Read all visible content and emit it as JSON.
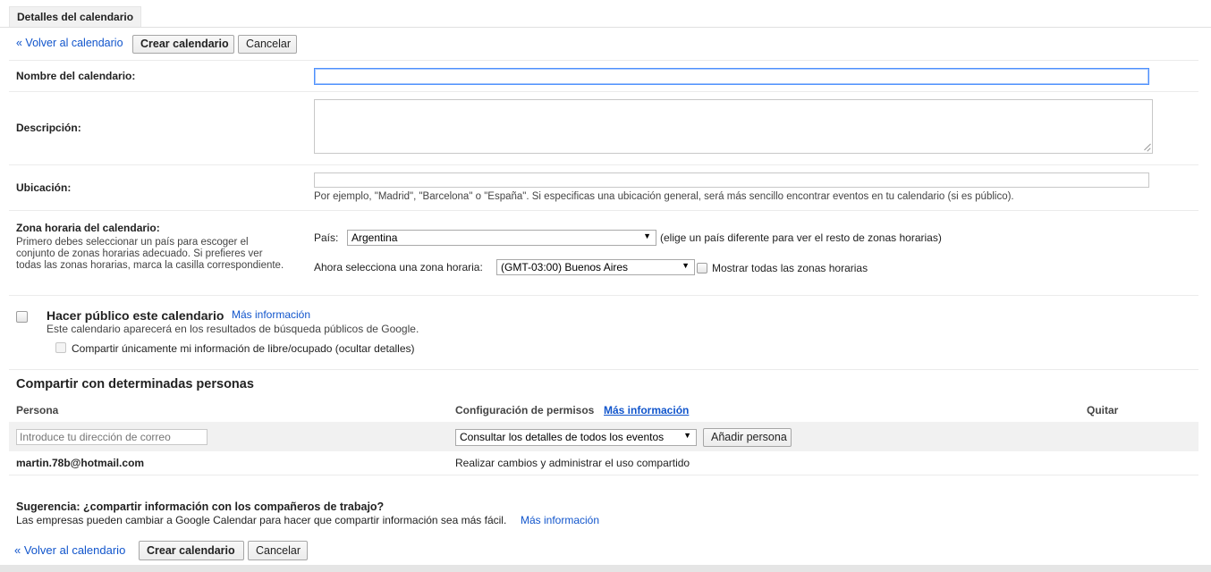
{
  "tab": {
    "label": "Detalles del calendario"
  },
  "toolbar": {
    "back_label": "« Volver al calendario",
    "create_label": "Crear calendario",
    "cancel_label": "Cancelar"
  },
  "form": {
    "name": {
      "label": "Nombre del calendario:",
      "value": ""
    },
    "description": {
      "label": "Descripción:",
      "value": ""
    },
    "location": {
      "label": "Ubicación:",
      "value": "",
      "hint": "Por ejemplo, \"Madrid\", \"Barcelona\" o \"España\". Si especificas una ubicación general, será más sencillo encontrar eventos en tu calendario (si es público)."
    },
    "timezone": {
      "label": "Zona horaria del calendario:",
      "help": "Primero debes seleccionar un país para escoger el conjunto de zonas horarias adecuado. Si prefieres ver todas las zonas horarias, marca la casilla correspondiente.",
      "country_label": "País:",
      "country_value": "Argentina",
      "country_hint": "(elige un país diferente para ver el resto de zonas horarias)",
      "zone_label": "Ahora selecciona una zona horaria:",
      "zone_value": "(GMT-03:00) Buenos Aires",
      "show_all_label": "Mostrar todas las zonas horarias"
    }
  },
  "public": {
    "title": "Hacer público este calendario",
    "more_info": "Más información",
    "description": "Este calendario aparecerá en los resultados de búsqueda públicos de Google.",
    "freebusy_label": "Compartir únicamente mi información de libre/ocupado (ocultar detalles)"
  },
  "sharing": {
    "title": "Compartir con determinadas personas",
    "col_person": "Persona",
    "col_permissions": "Configuración de permisos",
    "col_permissions_link": "Más información",
    "col_remove": "Quitar",
    "email_placeholder": "Introduce tu dirección de correo",
    "permission_value": "Consultar los detalles de todos los eventos",
    "add_person_label": "Añadir persona",
    "rows": [
      {
        "person": "martin.78b@hotmail.com",
        "permission": "Realizar cambios y administrar el uso compartido"
      }
    ]
  },
  "suggestion": {
    "title": "Sugerencia: ¿compartir información con los compañeros de trabajo?",
    "text": "Las empresas pueden cambiar a Google Calendar para hacer que compartir información sea más fácil.",
    "link": "Más información"
  },
  "colors": {
    "link": "#1155cc",
    "row_highlight": "#f1f1f1",
    "focus": "#4d90fe"
  }
}
